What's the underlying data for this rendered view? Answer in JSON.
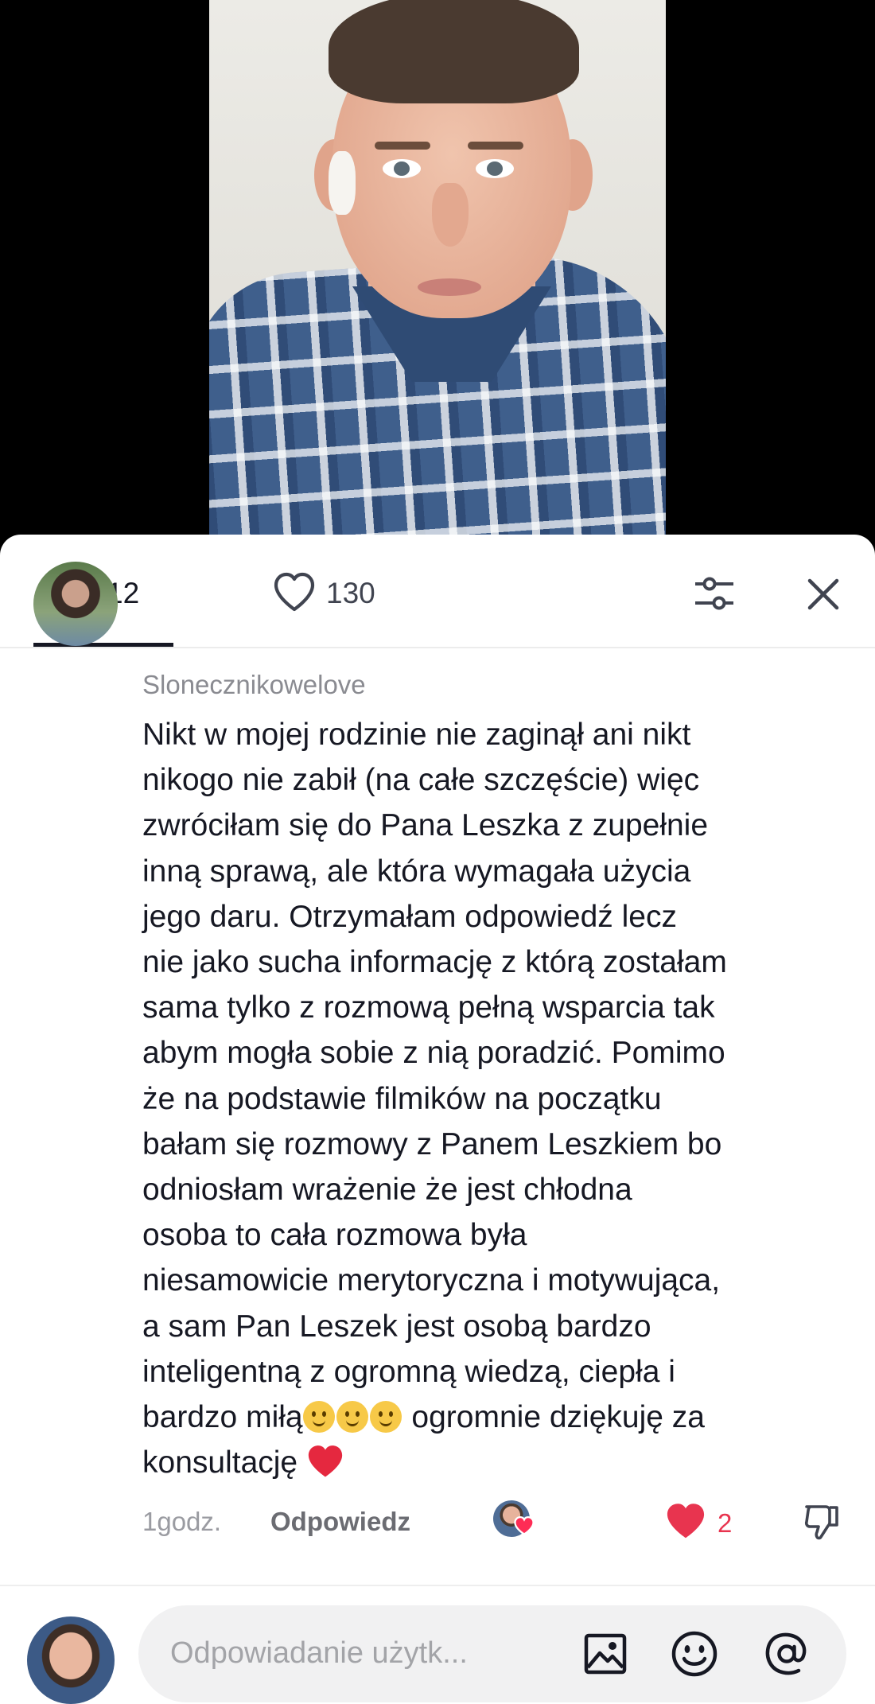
{
  "tabs": {
    "comments_count": "12",
    "likes_count": "130"
  },
  "comment": {
    "username": "Slonecznikowelove",
    "text_lines": [
      "Nikt w mojej rodzinie nie zaginął ani nikt",
      "nikogo nie zabił (na całe szczęście) więc",
      "zwróciłam się do Pana Leszka z zupełnie",
      "inną sprawą, ale która wymagała użycia",
      "jego daru. Otrzymałam odpowiedź lecz",
      "nie jako sucha informację z którą zostałam",
      "sama tylko z rozmową pełną wsparcia tak",
      "abym mogła sobie z nią poradzić. Pomimo",
      "że na podstawie filmików na początku",
      "bałam się rozmowy z Panem Leszkiem bo",
      "odniosłam wrażenie że jest chłodna",
      "osoba to cała rozmowa była",
      "niesamowicie merytoryczna i motywująca,",
      "a sam Pan Leszek jest osobą bardzo",
      "inteligentną z ogromną wiedzą, ciepła i"
    ],
    "line16_start": "bardzo miłą",
    "line16_end": " ogromnie dziękuję za",
    "line17": "konsultację",
    "time": "1godz.",
    "reply_label": "Odpowiedz",
    "like_count": "2"
  },
  "input": {
    "placeholder": "Odpowiadanie użytk..."
  },
  "colors": {
    "like_red": "#e8344f",
    "text_primary": "#161823",
    "text_secondary": "#8a8b91"
  }
}
